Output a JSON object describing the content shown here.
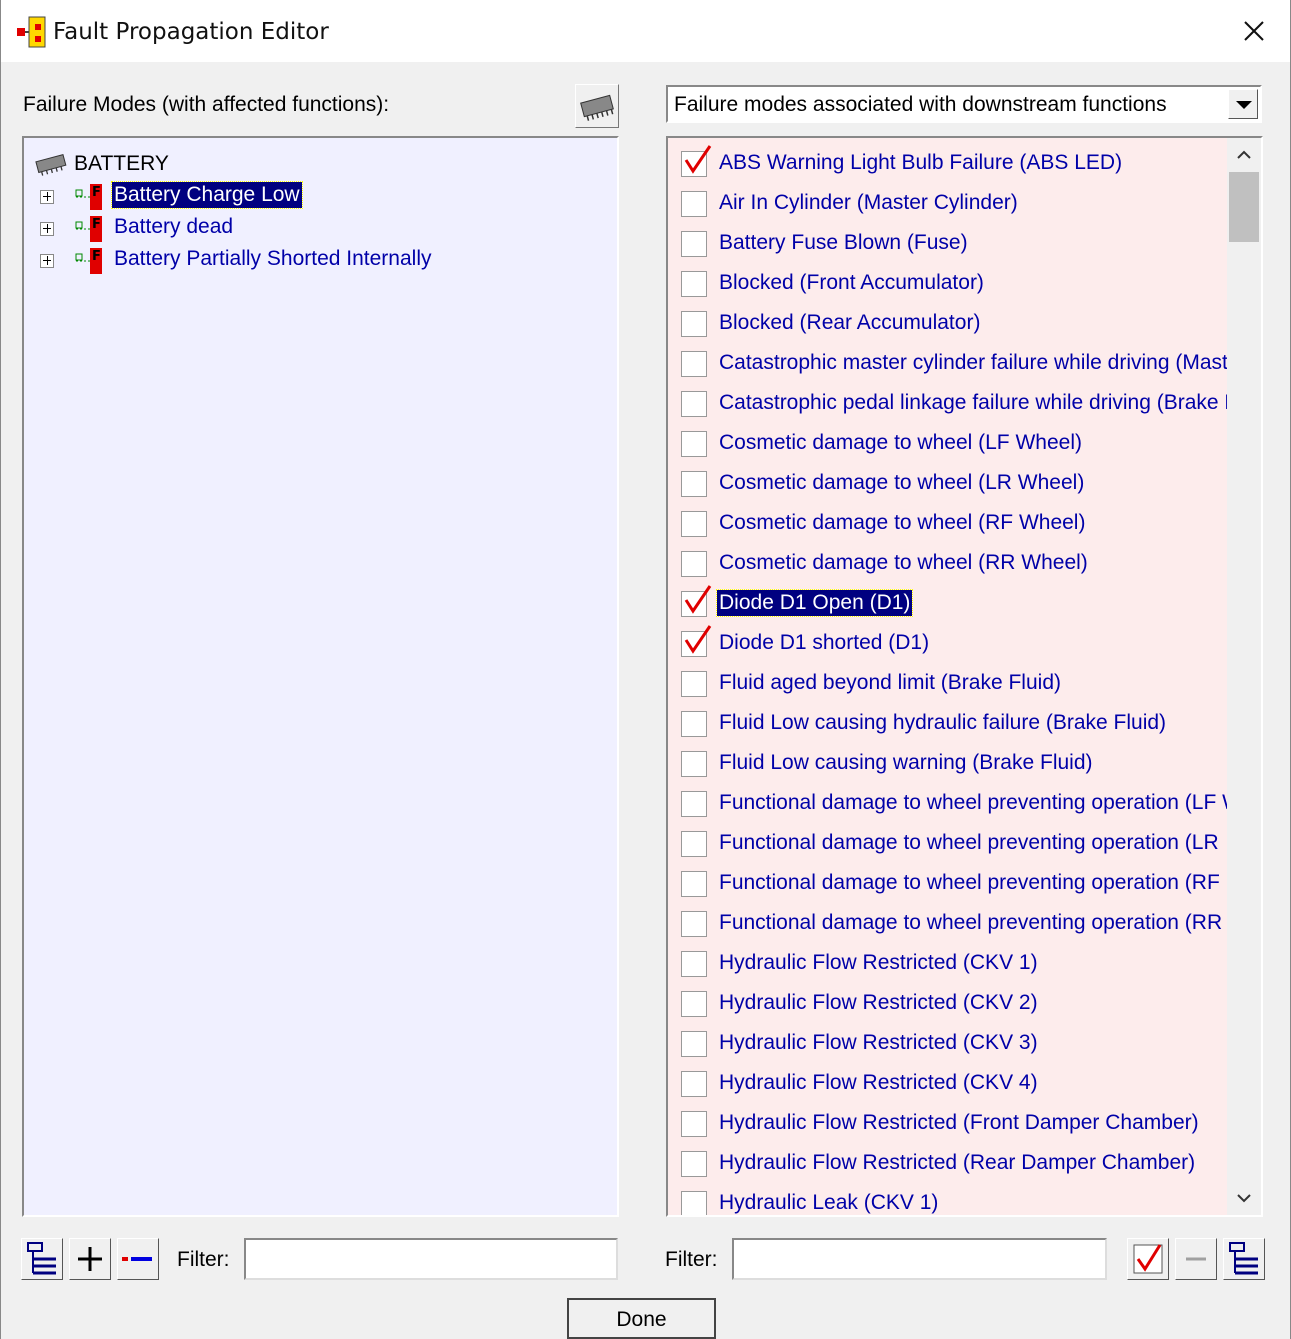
{
  "window": {
    "title": "Fault Propagation Editor",
    "icons": {
      "app": "app-icon",
      "close": "close-icon"
    }
  },
  "left_panel": {
    "label": "Failure Modes (with affected functions):",
    "chip_button_icon": "chip-icon",
    "tree": {
      "root_label": "BATTERY",
      "root_icon": "chip-icon",
      "items": [
        {
          "label": "Battery Charge Low",
          "selected": true,
          "icon": "failure-mode-icon"
        },
        {
          "label": "Battery dead",
          "selected": false,
          "icon": "failure-mode-icon"
        },
        {
          "label": "Battery Partially Shorted Internally",
          "selected": false,
          "icon": "failure-mode-icon"
        }
      ]
    },
    "filter_label": "Filter:",
    "filter_value": "",
    "buttons": [
      "tree-view-icon",
      "plus-icon",
      "minus-icon"
    ]
  },
  "right_panel": {
    "dropdown_value": "Failure modes associated with downstream functions",
    "items": [
      {
        "label": "ABS Warning Light Bulb Failure (ABS LED)",
        "checked": true,
        "selected": false
      },
      {
        "label": "Air In Cylinder (Master Cylinder)",
        "checked": false,
        "selected": false
      },
      {
        "label": "Battery Fuse Blown (Fuse)",
        "checked": false,
        "selected": false
      },
      {
        "label": "Blocked (Front Accumulator)",
        "checked": false,
        "selected": false
      },
      {
        "label": "Blocked (Rear Accumulator)",
        "checked": false,
        "selected": false
      },
      {
        "label": "Catastrophic master cylinder failure while driving (Maste",
        "checked": false,
        "selected": false
      },
      {
        "label": "Catastrophic pedal linkage failure while driving (Brake P",
        "checked": false,
        "selected": false
      },
      {
        "label": "Cosmetic damage to wheel (LF Wheel)",
        "checked": false,
        "selected": false
      },
      {
        "label": "Cosmetic damage to wheel (LR Wheel)",
        "checked": false,
        "selected": false
      },
      {
        "label": "Cosmetic damage to wheel (RF Wheel)",
        "checked": false,
        "selected": false
      },
      {
        "label": "Cosmetic damage to wheel (RR Wheel)",
        "checked": false,
        "selected": false
      },
      {
        "label": "Diode D1 Open (D1)",
        "checked": true,
        "selected": true
      },
      {
        "label": "Diode D1 shorted (D1)",
        "checked": true,
        "selected": false
      },
      {
        "label": "Fluid aged beyond limit (Brake Fluid)",
        "checked": false,
        "selected": false
      },
      {
        "label": "Fluid Low causing hydraulic failure (Brake Fluid)",
        "checked": false,
        "selected": false
      },
      {
        "label": "Fluid Low causing warning (Brake Fluid)",
        "checked": false,
        "selected": false
      },
      {
        "label": "Functional damage to wheel preventing operation (LF W",
        "checked": false,
        "selected": false
      },
      {
        "label": "Functional damage to wheel preventing operation (LR",
        "checked": false,
        "selected": false
      },
      {
        "label": "Functional damage to wheel preventing operation (RF",
        "checked": false,
        "selected": false
      },
      {
        "label": "Functional damage to wheel preventing operation (RR",
        "checked": false,
        "selected": false
      },
      {
        "label": "Hydraulic Flow Restricted (CKV 1)",
        "checked": false,
        "selected": false
      },
      {
        "label": "Hydraulic Flow Restricted (CKV 2)",
        "checked": false,
        "selected": false
      },
      {
        "label": "Hydraulic Flow Restricted (CKV 3)",
        "checked": false,
        "selected": false
      },
      {
        "label": "Hydraulic Flow Restricted (CKV 4)",
        "checked": false,
        "selected": false
      },
      {
        "label": "Hydraulic Flow Restricted (Front Damper Chamber)",
        "checked": false,
        "selected": false
      },
      {
        "label": "Hydraulic Flow Restricted (Rear Damper Chamber)",
        "checked": false,
        "selected": false
      },
      {
        "label": "Hydraulic Leak (CKV 1)",
        "checked": false,
        "selected": false
      }
    ],
    "filter_label": "Filter:",
    "filter_value": "",
    "buttons": [
      "check-all-icon",
      "uncheck-icon",
      "tree-view-icon"
    ]
  },
  "done_label": "Done",
  "colors": {
    "tree_bg": "#f0f0ff",
    "list_bg": "#fdecec",
    "item_text": "#0000a8",
    "selection": "#000080",
    "check_mark": "#e00000"
  }
}
